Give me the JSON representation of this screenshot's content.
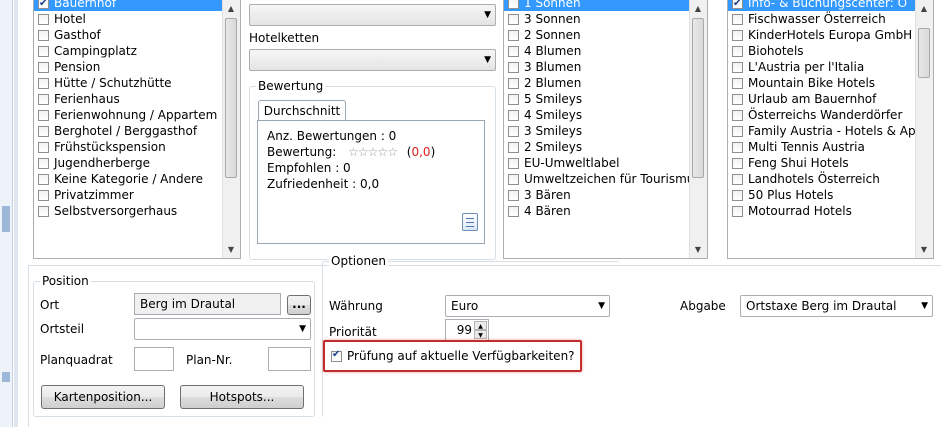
{
  "categories": {
    "items": [
      {
        "label": "Bauernhof",
        "checked": true,
        "selected": true
      },
      {
        "label": "Hotel",
        "checked": false
      },
      {
        "label": "Gasthof",
        "checked": false
      },
      {
        "label": "Campingplatz",
        "checked": false
      },
      {
        "label": "Pension",
        "checked": false
      },
      {
        "label": "Hütte / Schutzhütte",
        "checked": false
      },
      {
        "label": "Ferienhaus",
        "checked": false
      },
      {
        "label": "Ferienwohnung / Appartem",
        "checked": false
      },
      {
        "label": "Berghotel / Berggasthof",
        "checked": false
      },
      {
        "label": "Frühstückspension",
        "checked": false
      },
      {
        "label": "Jugendherberge",
        "checked": false
      },
      {
        "label": "Keine Kategorie / Andere",
        "checked": false
      },
      {
        "label": "Privatzimmer",
        "checked": false
      },
      {
        "label": "Selbstversorgerhaus",
        "checked": false
      }
    ]
  },
  "hotelketten": {
    "label": "Hotelketten",
    "value": ""
  },
  "bewertung": {
    "group_label": "Bewertung",
    "tab": "Durchschnitt",
    "count_line": "Anz. Bewertungen : 0",
    "rating_label": "Bewertung:",
    "stars": "☆☆☆☆☆",
    "rating_open": "(",
    "rating_value": "0,0",
    "rating_close": ")",
    "empfohlen": "Empfohlen : 0",
    "zufriedenheit": "Zufriedenheit : 0,0"
  },
  "ratings": {
    "items": [
      {
        "label": "1 Sonnen",
        "checked": false,
        "selected": true
      },
      {
        "label": "3 Sonnen",
        "checked": false
      },
      {
        "label": "2 Sonnen",
        "checked": false
      },
      {
        "label": "4 Blumen",
        "checked": false
      },
      {
        "label": "3 Blumen",
        "checked": false
      },
      {
        "label": "2 Blumen",
        "checked": false
      },
      {
        "label": "5 Smileys",
        "checked": false
      },
      {
        "label": "4 Smileys",
        "checked": false
      },
      {
        "label": "3 Smileys",
        "checked": false
      },
      {
        "label": "2 Smileys",
        "checked": false
      },
      {
        "label": "EU-Umweltlabel",
        "checked": false
      },
      {
        "label": "Umweltzeichen für Tourismu",
        "checked": false
      },
      {
        "label": "3 Bären",
        "checked": false
      },
      {
        "label": "4 Bären",
        "checked": false
      }
    ]
  },
  "groups": {
    "items": [
      {
        "label": "Info- & Buchungscenter: Ö",
        "checked": true,
        "selected": true
      },
      {
        "label": "Fischwasser Österreich",
        "checked": false
      },
      {
        "label": "KinderHotels Europa GmbH",
        "checked": false
      },
      {
        "label": "Biohotels",
        "checked": false
      },
      {
        "label": "L'Austria per l'Italia",
        "checked": false
      },
      {
        "label": "Mountain Bike Hotels",
        "checked": false
      },
      {
        "label": "Urlaub am Bauernhof",
        "checked": false
      },
      {
        "label": "Österreichs Wanderdörfer",
        "checked": false
      },
      {
        "label": "Family Austria - Hotels & Ap",
        "checked": false
      },
      {
        "label": "Multi Tennis Austria",
        "checked": false
      },
      {
        "label": "Feng Shui Hotels",
        "checked": false
      },
      {
        "label": "Landhotels Österreich",
        "checked": false
      },
      {
        "label": "50 Plus Hotels",
        "checked": false
      },
      {
        "label": "Motourrad Hotels",
        "checked": false
      }
    ]
  },
  "position": {
    "group_label": "Position",
    "ort_label": "Ort",
    "ort_value": "Berg im Drautal",
    "browse_label": "...",
    "ortsteil_label": "Ortsteil",
    "ortsteil_value": "",
    "planquadrat_label": "Planquadrat",
    "plannr_label": "Plan-Nr.",
    "kartenposition_button": "Kartenposition...",
    "hotspots_button": "Hotspots..."
  },
  "optionen": {
    "group_label": "Optionen",
    "waehrung_label": "Währung",
    "waehrung_value": "Euro",
    "prioritaet_label": "Priorität",
    "prioritaet_value": "99",
    "check_label": "Prüfung auf aktuelle Verfügbarkeiten?",
    "check_checked": true,
    "abgabe_label": "Abgabe",
    "abgabe_value": "Ortstaxe Berg im Drautal"
  },
  "colors": {
    "selection": "#3399ff",
    "highlight_border": "#c42b2b",
    "rating_red": "#e02020"
  }
}
